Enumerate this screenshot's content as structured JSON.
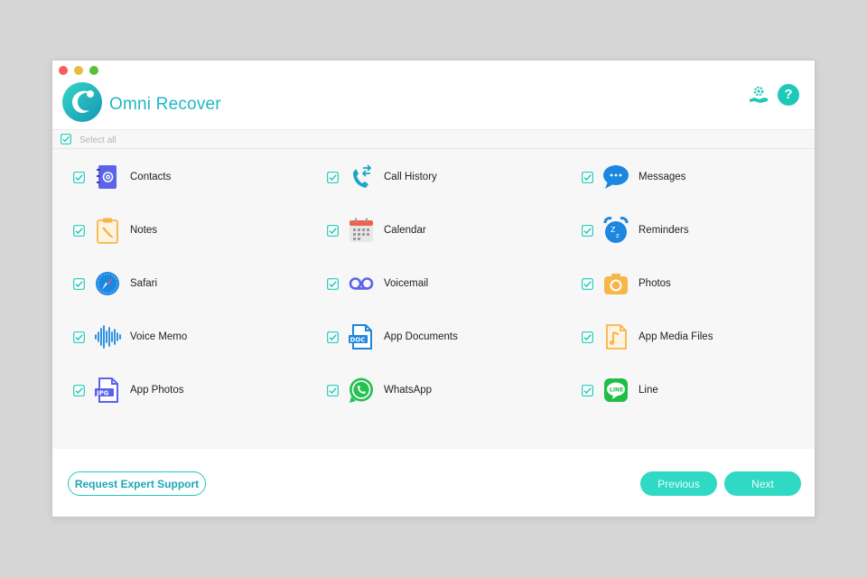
{
  "app": {
    "title": "Omni Recover"
  },
  "colors": {
    "accent": "#1fc9b8",
    "title": "#1fb8c4",
    "button_fill": "#2fd9c4"
  },
  "select_all": {
    "label": "Select all",
    "checked": true
  },
  "items": [
    {
      "label": "Contacts",
      "icon": "contacts-book-icon",
      "checked": true
    },
    {
      "label": "Call History",
      "icon": "phone-call-icon",
      "checked": true
    },
    {
      "label": "Messages",
      "icon": "chat-bubble-icon",
      "checked": true
    },
    {
      "label": "Notes",
      "icon": "notes-clipboard-icon",
      "checked": true
    },
    {
      "label": "Calendar",
      "icon": "calendar-icon",
      "checked": true
    },
    {
      "label": "Reminders",
      "icon": "alarm-clock-icon",
      "checked": true
    },
    {
      "label": "Safari",
      "icon": "compass-icon",
      "checked": true
    },
    {
      "label": "Voicemail",
      "icon": "voicemail-icon",
      "checked": true
    },
    {
      "label": "Photos",
      "icon": "camera-icon",
      "checked": true
    },
    {
      "label": "Voice Memo",
      "icon": "soundwave-icon",
      "checked": true
    },
    {
      "label": "App Documents",
      "icon": "doc-file-icon",
      "checked": true
    },
    {
      "label": "App Media Files",
      "icon": "media-file-icon",
      "checked": true
    },
    {
      "label": "App Photos",
      "icon": "jpg-file-icon",
      "checked": true
    },
    {
      "label": "WhatsApp",
      "icon": "whatsapp-icon",
      "checked": true
    },
    {
      "label": "Line",
      "icon": "line-icon",
      "checked": true
    }
  ],
  "footer": {
    "support_label": "Request Expert Support",
    "previous_label": "Previous",
    "next_label": "Next"
  }
}
